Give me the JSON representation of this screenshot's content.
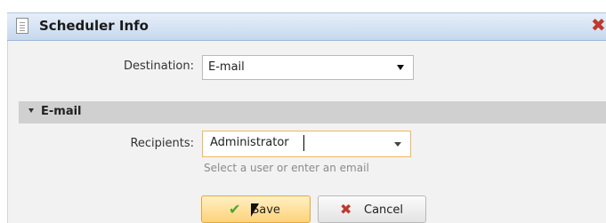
{
  "dialog": {
    "title": "Scheduler Info",
    "title_icon": "document-icon",
    "close_icon": "close-icon",
    "close_glyph": "✖"
  },
  "destination": {
    "label": "Destination:",
    "value": "E-mail"
  },
  "section": {
    "title": "E-mail"
  },
  "recipients": {
    "label": "Recipients:",
    "value": "Administrator",
    "hint": "Select a user or enter an email"
  },
  "buttons": {
    "save_label": "Save",
    "save_icon": "checkmark-icon",
    "save_glyph": "✔",
    "cancel_label": "Cancel",
    "cancel_icon": "x-icon",
    "cancel_glyph": "✖"
  },
  "colors": {
    "save_check": "#4aa52e",
    "cancel_x": "#c0392b"
  }
}
